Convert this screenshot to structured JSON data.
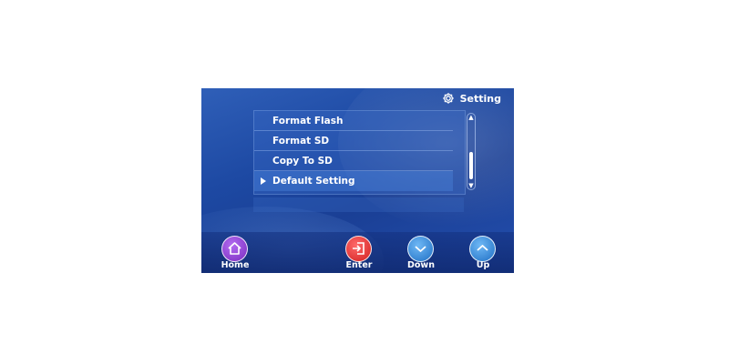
{
  "header": {
    "title": "Setting",
    "icon": "gear-icon"
  },
  "menu": {
    "items": [
      {
        "label": "Format Flash",
        "selected": false
      },
      {
        "label": "Format SD",
        "selected": false
      },
      {
        "label": "Copy To SD",
        "selected": false
      },
      {
        "label": "Default Setting",
        "selected": true
      }
    ]
  },
  "buttons": {
    "home": {
      "label": "Home",
      "icon": "home-icon",
      "color": "#8a3bd1"
    },
    "enter": {
      "label": "Enter",
      "icon": "enter-icon",
      "color": "#e03030"
    },
    "down": {
      "label": "Down",
      "icon": "chevron-down-icon",
      "color": "#2f86d6"
    },
    "up": {
      "label": "Up",
      "icon": "chevron-up-icon",
      "color": "#2f86d6"
    }
  }
}
